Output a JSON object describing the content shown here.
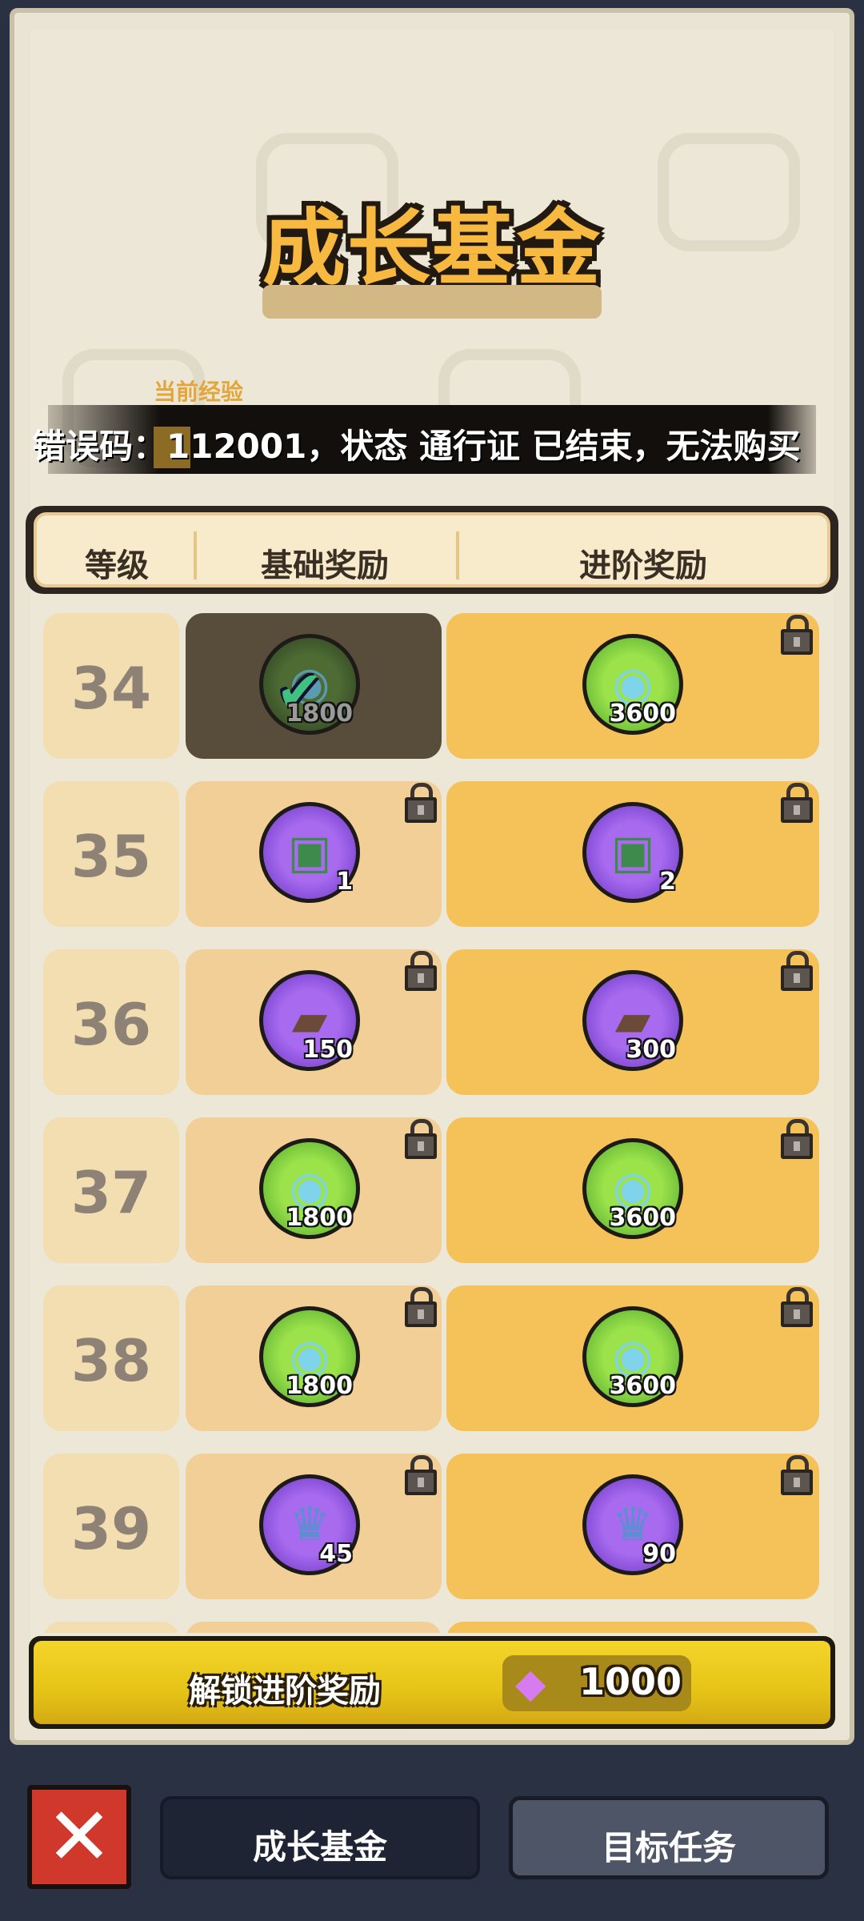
{
  "title": "成长基金",
  "exp_label": "当前经验",
  "error_message": "错误码：112001，状态 通行证 已结束，无法购买",
  "table_header": {
    "level": "等级",
    "basic": "基础奖励",
    "advanced": "进阶奖励"
  },
  "rows": [
    {
      "level": "34",
      "basic": {
        "qty": "1800",
        "claimed": true
      },
      "advanced": {
        "qty": "3600",
        "locked": true
      }
    },
    {
      "level": "35",
      "basic": {
        "qty": "1",
        "locked": true
      },
      "advanced": {
        "qty": "2",
        "locked": true
      }
    },
    {
      "level": "36",
      "basic": {
        "qty": "150",
        "locked": true
      },
      "advanced": {
        "qty": "300",
        "locked": true
      }
    },
    {
      "level": "37",
      "basic": {
        "qty": "1800",
        "locked": true
      },
      "advanced": {
        "qty": "3600",
        "locked": true
      }
    },
    {
      "level": "38",
      "basic": {
        "qty": "1800",
        "locked": true
      },
      "advanced": {
        "qty": "3600",
        "locked": true
      }
    },
    {
      "level": "39",
      "basic": {
        "qty": "45",
        "locked": true
      },
      "advanced": {
        "qty": "90",
        "locked": true
      }
    }
  ],
  "unlock_button": {
    "label": "解锁进阶奖励",
    "price": "1000",
    "currency_icon": "diamond-icon"
  },
  "bottom_nav": {
    "close_icon": "close-icon",
    "tabs": [
      {
        "label": "成长基金",
        "active": true
      },
      {
        "label": "目标任务",
        "active": false
      }
    ]
  },
  "colors": {
    "accent_orange": "#f7b93f",
    "advanced_bg": "#f5c159",
    "basic_bg": "#f1cf96",
    "button_yellow": "#f4d52b",
    "close_red": "#d0382c"
  }
}
